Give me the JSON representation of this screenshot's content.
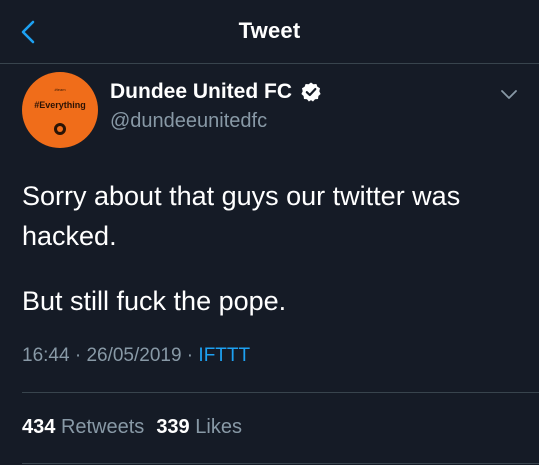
{
  "header": {
    "title": "Tweet"
  },
  "author": {
    "avatar_small_text": "#team",
    "avatar_tag": "#Everything",
    "display_name": "Dundee United FC",
    "handle": "@dundeeunitedfc",
    "verified": true
  },
  "tweet": {
    "line1": "Sorry about that guys our twitter was",
    "line2": "hacked.",
    "line3": "But still fuck the pope."
  },
  "meta": {
    "time": "16:44",
    "sep1": " · ",
    "date": "26/05/2019",
    "sep2": " · ",
    "source": "IFTTT"
  },
  "stats": {
    "retweets_count": "434",
    "retweets_label": "Retweets",
    "likes_count": "339",
    "likes_label": "Likes"
  },
  "colors": {
    "background": "#151b26",
    "accent": "#1da1f2",
    "secondary_text": "#8899a6",
    "avatar_orange": "#f06d1a"
  },
  "icons": {
    "back": "chevron-left-icon",
    "verified": "verified-badge-icon",
    "more": "chevron-down-icon"
  }
}
